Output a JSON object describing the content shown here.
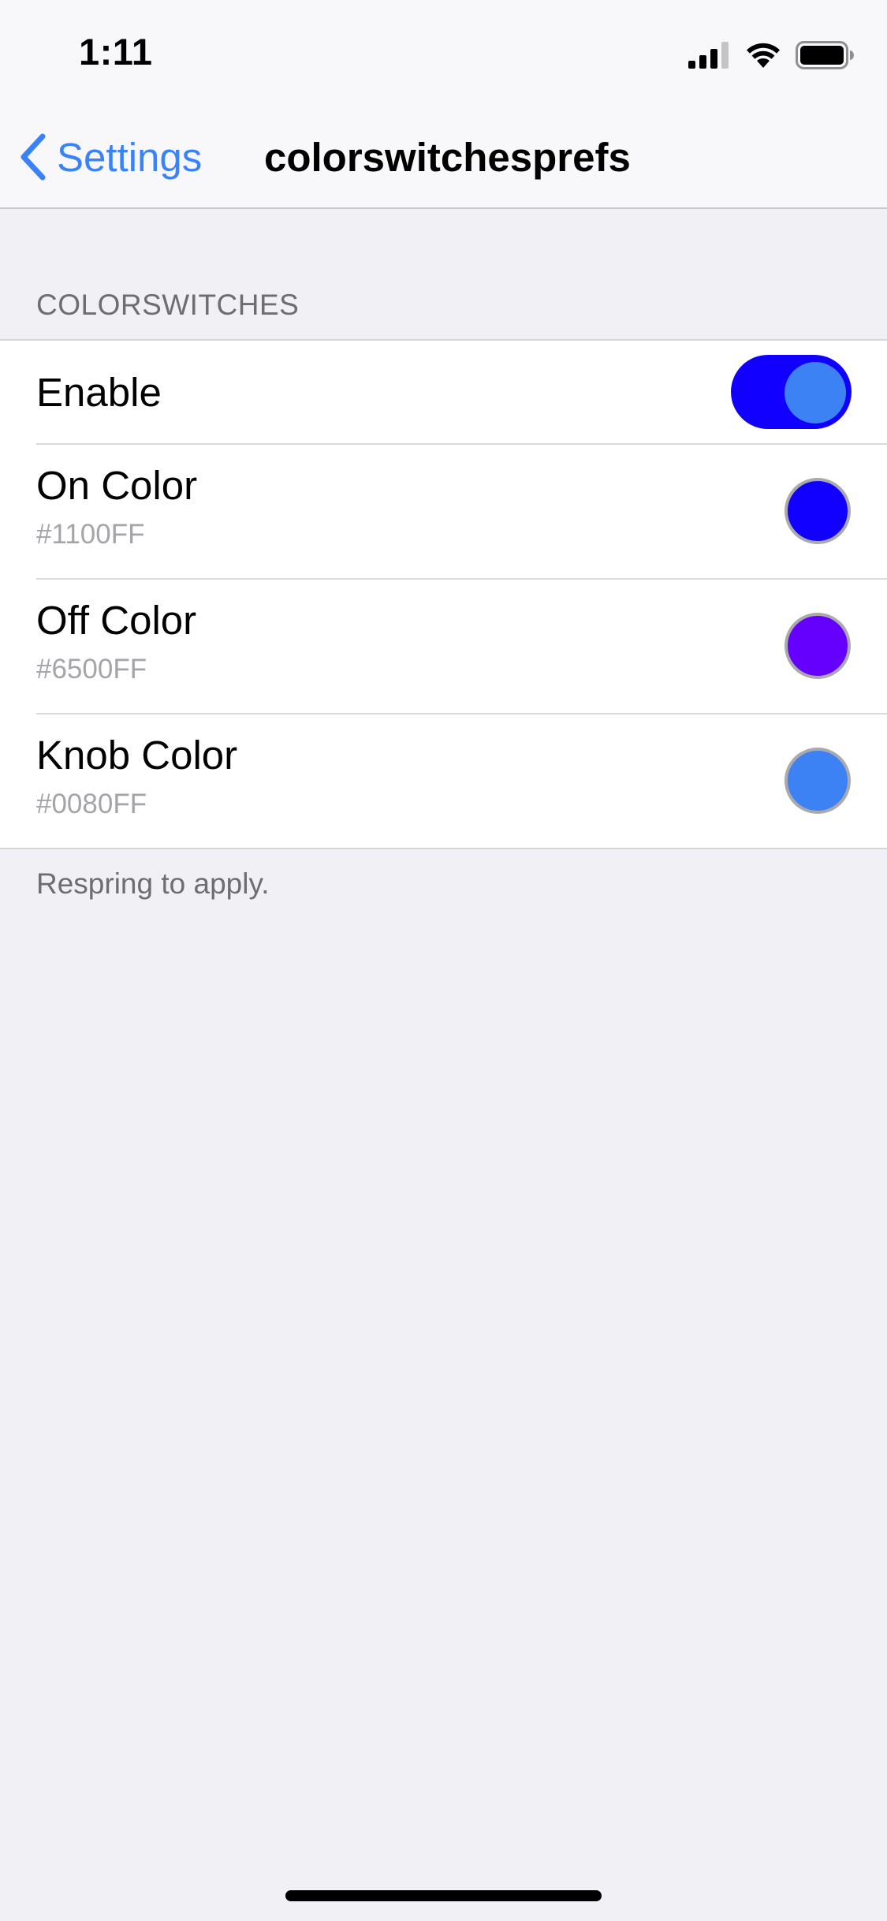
{
  "status_bar": {
    "time": "1:11",
    "icons": [
      "signal-icon",
      "wifi-icon",
      "battery-icon"
    ]
  },
  "nav": {
    "back_label": "Settings",
    "title": "colorswitchesprefs",
    "accent_color": "#3a82f7"
  },
  "section": {
    "header": "COLORSWITCHES",
    "footer": "Respring to apply."
  },
  "enable": {
    "label": "Enable",
    "on": true,
    "track_color": "#1100FF",
    "knob_color": "#3d82f4"
  },
  "color_rows": [
    {
      "label": "On Color",
      "value": "#1100FF",
      "swatch_color": "#1100FF"
    },
    {
      "label": "Off Color",
      "value": "#6500FF",
      "swatch_color": "#6500FF"
    },
    {
      "label": "Knob Color",
      "value": "#0080FF",
      "swatch_color": "#3d82f4"
    }
  ]
}
